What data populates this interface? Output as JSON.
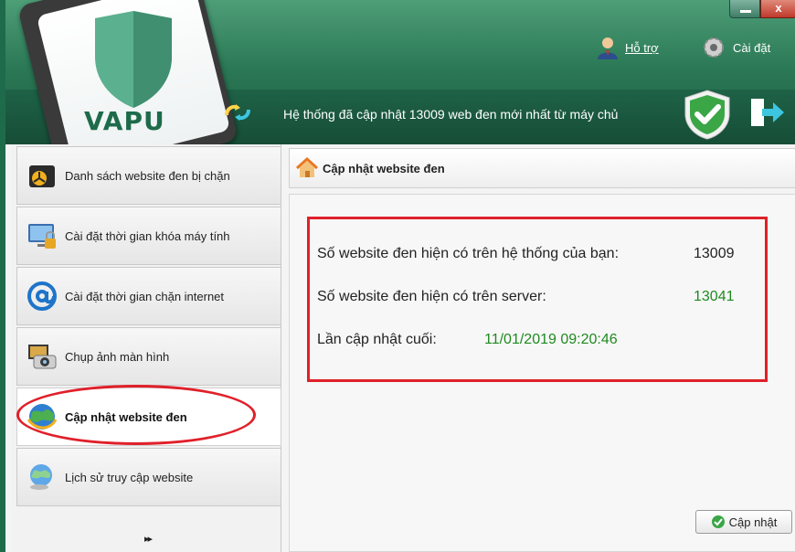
{
  "window": {
    "close_glyph": "x"
  },
  "brand": {
    "logo_text": "VAPU",
    "color": "#1e6b4b"
  },
  "header": {
    "support_label": "Hỗ trợ",
    "settings_label": "Cài đặt",
    "status_message": "Hệ thống đã cập nhật 13009 web đen mới nhất từ máy chủ"
  },
  "sidebar": {
    "items": [
      {
        "label": "Danh sách website đen bị chặn",
        "icon": "blocked-list-icon"
      },
      {
        "label": "Cài đặt thời gian khóa máy tính",
        "icon": "computer-lock-icon"
      },
      {
        "label": "Cài đặt thời gian chặn internet",
        "icon": "at-sign-icon"
      },
      {
        "label": "Chụp ảnh màn hình",
        "icon": "camera-icon"
      },
      {
        "label": "Cập nhật website đen",
        "icon": "globe-update-icon",
        "active": true
      },
      {
        "label": "Lịch sử truy cập website",
        "icon": "globe-history-icon"
      }
    ],
    "more": "▸▸"
  },
  "main": {
    "title": "Cập nhật website đen",
    "rows": [
      {
        "label": "Số website đen hiện có trên hệ thống của bạn:",
        "value": "13009",
        "value_color": "#222222"
      },
      {
        "label": "Số website đen hiện có trên server:",
        "value": "13041",
        "value_color": "#1f8a1f"
      },
      {
        "label": "Lần cập nhật cuối:",
        "value": "11/01/2019 09:20:46",
        "value_color": "#1f8a1f"
      }
    ],
    "update_button": "Cập nhật"
  },
  "colors": {
    "highlight": "#e0202a",
    "accent_green": "#1f8a1f"
  }
}
